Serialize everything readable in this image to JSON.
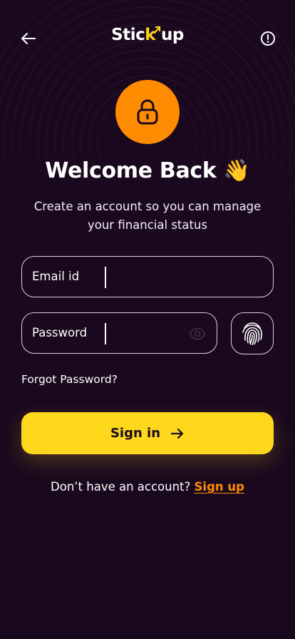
{
  "app": {
    "logo_text_start": "Stic",
    "logo_text_accent": "k",
    "logo_text_end": "up"
  },
  "header": {
    "back_icon": "arrow-left-icon",
    "info_icon": "alert-circle-icon"
  },
  "hero": {
    "icon": "lock-icon",
    "title": "Welcome Back 👋",
    "subtitle": "Create an account so you can manage your financial status"
  },
  "form": {
    "email": {
      "label": "Email id",
      "value": ""
    },
    "password": {
      "label": "Password",
      "value": "",
      "toggle_icon": "eye-icon"
    },
    "biometric_icon": "fingerprint-icon",
    "forgot_label": "Forgot Password?",
    "submit_label": "Sign in"
  },
  "footer": {
    "prompt": "Don’t have an account?",
    "link": "Sign up"
  },
  "colors": {
    "background": "#1a091e",
    "accent_orange": "#ff8c00",
    "accent_yellow": "#fdd81c",
    "text": "#ffffff"
  }
}
